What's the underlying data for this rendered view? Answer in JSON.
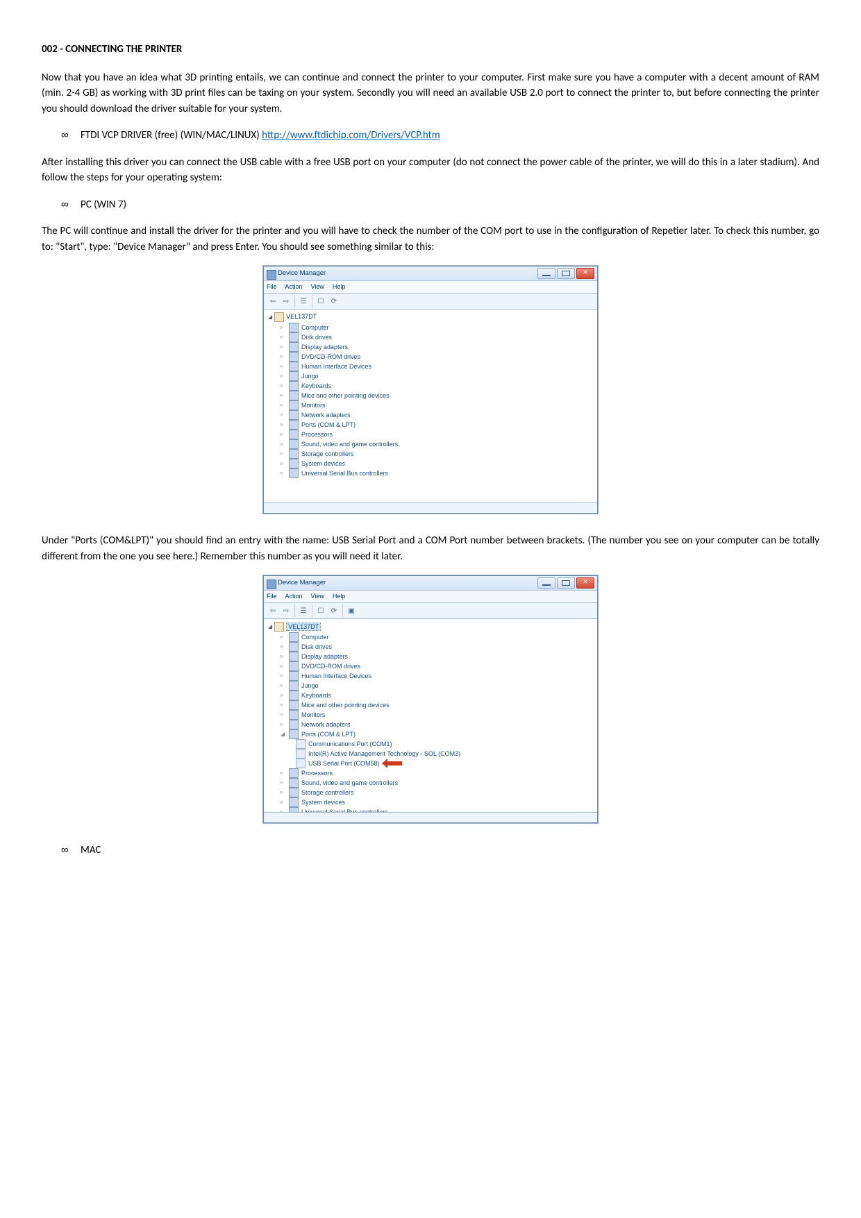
{
  "title": "002 - CONNECTING THE PRINTER",
  "para1": "Now that you have an idea what 3D printing entails, we can continue and connect the printer to your computer. First make sure you have a computer with a decent amount of RAM (min. 2-4 GB) as working with 3D print files can be taxing on your system. Secondly you will need an available USB 2.0 port to connect the printer to, but before connecting the printer you should download the driver suitable for your system.",
  "bullet1": {
    "symbol": "∞",
    "text": "FTDI VCP DRIVER (free) (WIN/MAC/LINUX) ",
    "link": "http://www.ftdichip.com/Drivers/VCP.htm"
  },
  "para2": "After installing this driver you can connect the USB cable with a free USB port on your computer (do not connect the power cable of the printer, we will do this in a later stadium). And follow the steps for your operating system:",
  "bullet2": {
    "symbol": "∞",
    "text": "PC (WIN 7)"
  },
  "para3": "The PC will continue and install the driver for the printer and you will have to check the number of the COM port to use in the configuration of Repetier later. To check this number, go to: \"Start\", type: \"Device Manager\" and press Enter. You should see something similar to this:",
  "para4": "Under \"Ports (COM&LPT)\" you should find an entry with the name: USB Serial Port and a COM Port number between brackets. (The number you see on your computer can be totally different from the one you see here.) Remember this number as you will need it later.",
  "bullet3": {
    "symbol": "∞",
    "text": "MAC"
  },
  "dm": {
    "title": "Device Manager",
    "menu": [
      "File",
      "Action",
      "View",
      "Help"
    ],
    "root": "VEL137DT",
    "items": [
      "Computer",
      "Disk drives",
      "Display adapters",
      "DVD/CD-ROM drives",
      "Human Interface Devices",
      "Jungo",
      "Keyboards",
      "Mice and other pointing devices",
      "Monitors",
      "Network adapters",
      "Ports (COM & LPT)",
      "Processors",
      "Sound, video and game controllers",
      "Storage controllers",
      "System devices",
      "Universal Serial Bus controllers"
    ],
    "ports_sub": [
      "Communications Port (COM1)",
      "Intel(R) Active Management Technology - SOL (COM3)",
      "USB Serial Port (COM58)"
    ]
  }
}
